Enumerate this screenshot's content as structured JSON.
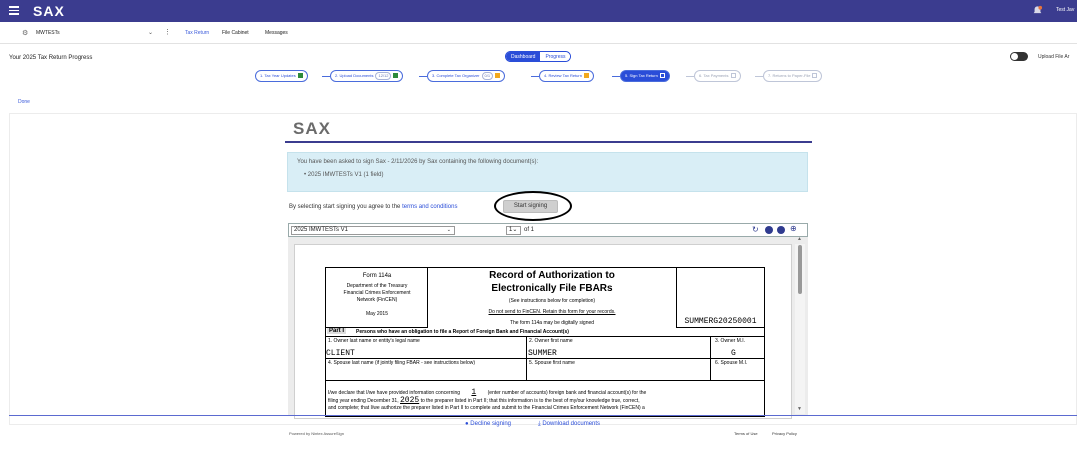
{
  "app": {
    "logo": "SAX",
    "user": "Test Jav"
  },
  "client_bar": {
    "client": "MWTESTs",
    "tabs": [
      "Tax Return",
      "File Cabinet",
      "Messages"
    ]
  },
  "progress": {
    "title": "Your 2025 Tax Return Progress",
    "dashboard_label": "Dashboard",
    "progress_label": "Progress",
    "upload_label": "Upload File Ar",
    "steps": [
      {
        "label": "1. Tax Year Updates",
        "status": "complete"
      },
      {
        "label": "2. Upload Documents",
        "count": "12/12",
        "status": "complete"
      },
      {
        "label": "3. Complete Tax Organizer",
        "count": "0/1",
        "status": "in-progress"
      },
      {
        "label": "4. Review Tax Return",
        "status": "in-progress"
      },
      {
        "label": "5. Sign Tax Return",
        "status": "current"
      },
      {
        "label": "6. Tax Payments",
        "status": "not-started"
      },
      {
        "label": "7. Returns to Paper-File",
        "status": "not-started"
      }
    ]
  },
  "done_label": "Done",
  "signing": {
    "logo": "SAX",
    "notice": "You have been asked to sign Sax - 2/11/2026 by Sax containing the following document(s):",
    "documents": [
      "2025 IMWTESTs V1 (1 field)"
    ],
    "agree_prefix": "By selecting start signing you agree to the",
    "terms_link": "terms and conditions",
    "start_button": "Start signing",
    "selected_document": "2025 IMWTESTs V1",
    "page": "1",
    "page_of": "of 1",
    "decline": "Decline signing",
    "download": "Download documents",
    "powered_by": "Powered by Nintex AssureSign",
    "terms_of_use": "Terms of Use",
    "privacy": "Privacy Policy"
  },
  "form": {
    "form_no": "Form 114a",
    "dept": "Department of the Treasury",
    "agency": "Financial Crimes Enforcement",
    "network": "Network (FinCEN)",
    "date": "May 2015",
    "title1": "Record of Authorization to",
    "title2": "Electronically File FBARs",
    "instructions": "(See instructions below for completion)",
    "do_not_send": "Do not send to FinCEN. Retain this form for your records.",
    "digital": "The form 114a may be digitally signed",
    "code": "SUMMERG20250001",
    "part1_label": "Part I",
    "part1_text": "Persons who have an obligation to file a Report of Foreign Bank and Financial Account(s)",
    "f1": "1. Owner last name or entity's legal name",
    "f2": "2. Owner first name",
    "f3": "3. Owner M.I.",
    "v1": "CLIENT",
    "v2": "SUMMER",
    "v3": "G",
    "f4": "4. Spouse last name (if jointly filing FBAR - see instructions below)",
    "f5": "5. Spouse first name",
    "f6": "6. Spouse M.I.",
    "decl1a": "I/we declare that I/we have provided information concerning",
    "accounts": "1",
    "decl1b": "(enter number of accounts) foreign bank and financial account(s) for the",
    "decl2a": "filing year ending December 31,",
    "year": "2025",
    "decl2b": "to the preparer listed in Part II; that this information is to the best of my/our knowledge true, correct,",
    "decl3": "and complete; that I/we authorize the preparer listed in Part II to complete and submit to the Financial Crimes Enforcement Network (FinCEN) a"
  },
  "colors": {
    "brand": "#3b3c8f",
    "accent": "#2a4dd8",
    "notice_bg": "#d9eef6"
  }
}
